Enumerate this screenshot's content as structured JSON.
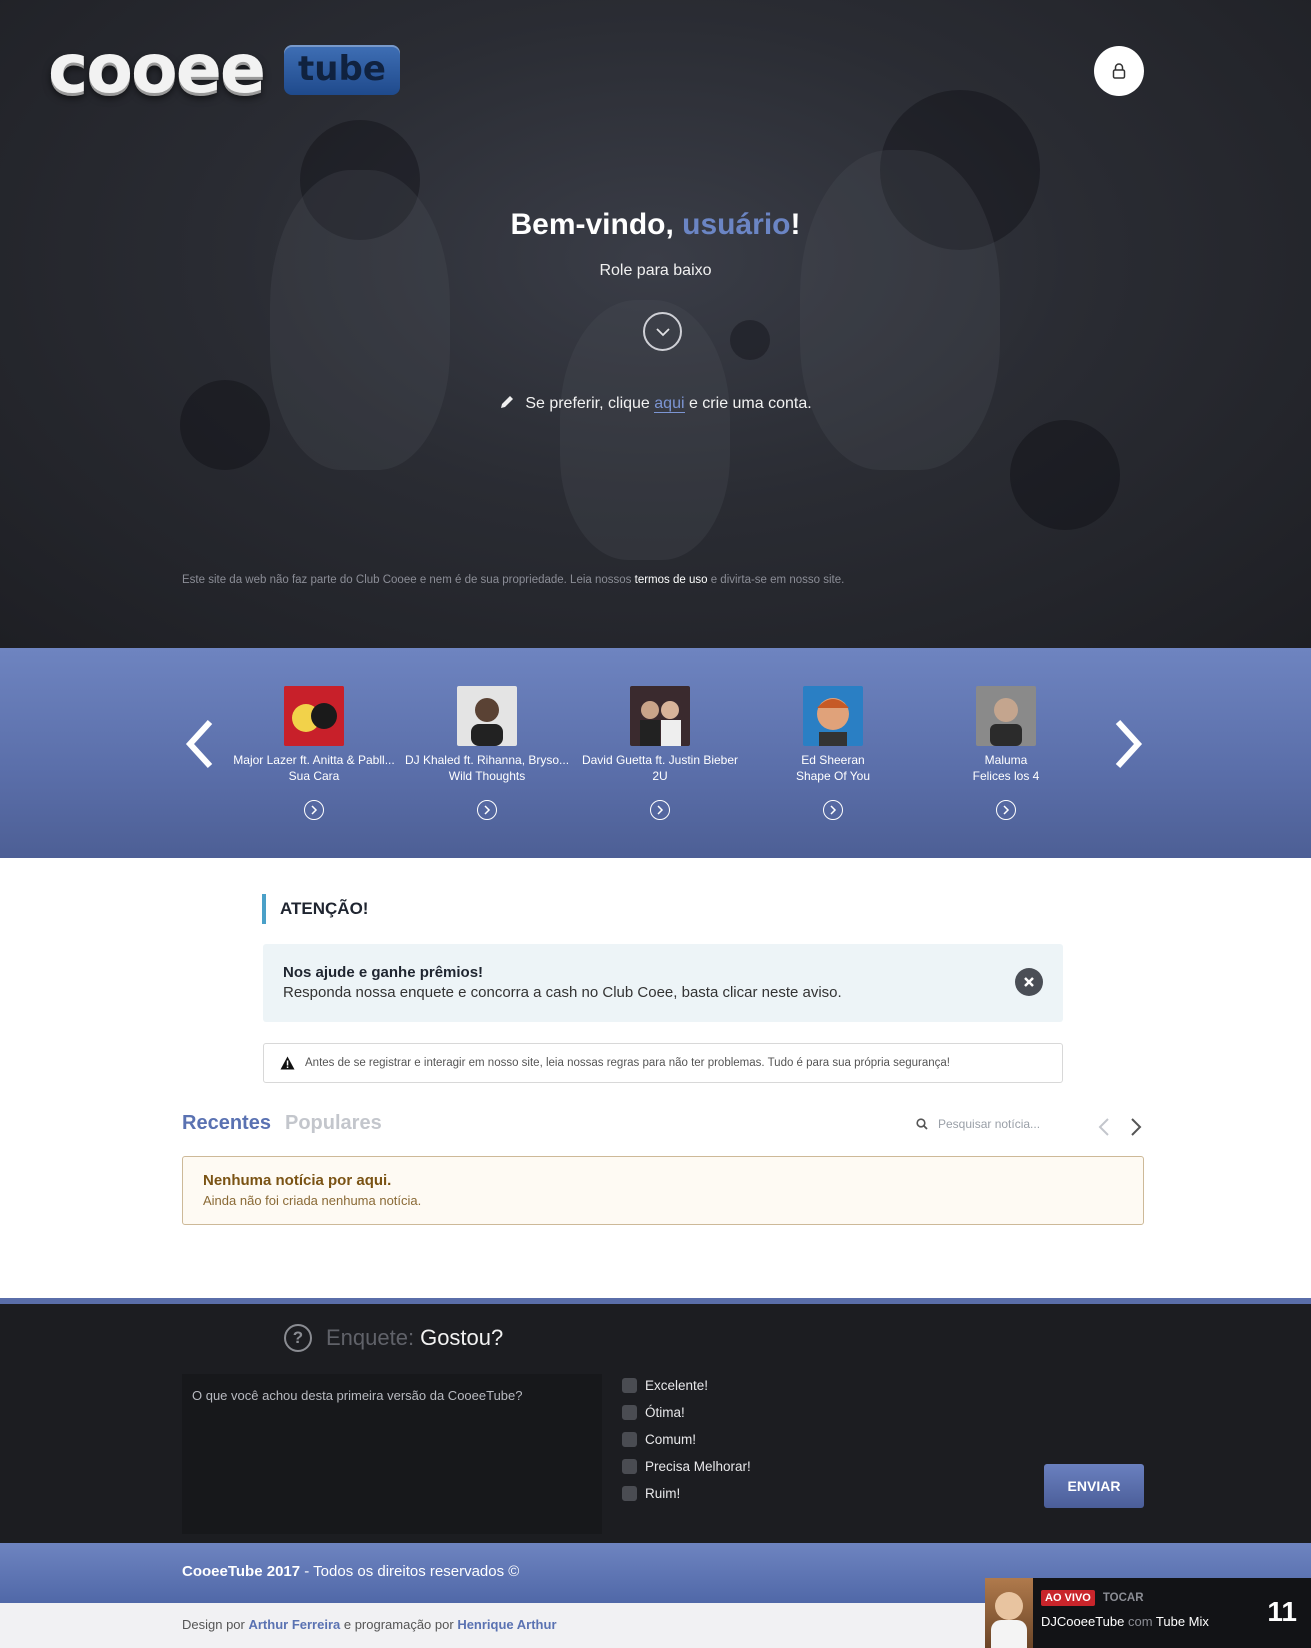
{
  "hero": {
    "welcome_prefix": "Bem-vindo, ",
    "username": "usuário",
    "welcome_suffix": "!",
    "scroll_hint": "Role para baixo",
    "cta_prefix": "Se preferir, clique ",
    "cta_link": "aqui",
    "cta_suffix": " e crie uma conta.",
    "disclaimer_prefix": "Este site da web não faz parte do Club Cooee e nem é de sua propriedade. Leia nossos ",
    "terms_link": "termos de uso",
    "disclaimer_suffix": " e divirta-se em nosso site."
  },
  "logo": {
    "main": "cooee",
    "badge": "tube"
  },
  "carousel": {
    "items": [
      {
        "artist": "Major Lazer ft. Anitta & Pabll...",
        "song": "Sua Cara",
        "thumb_color": "#c8202a"
      },
      {
        "artist": "DJ Khaled ft. Rihanna, Bryso...",
        "song": "Wild Thoughts",
        "thumb_color": "#d8d8d8"
      },
      {
        "artist": "David Guetta ft. Justin Bieber",
        "song": "2U",
        "thumb_color": "#3a2a2e"
      },
      {
        "artist": "Ed Sheeran",
        "song": "Shape Of You",
        "thumb_color": "#2a7fc4"
      },
      {
        "artist": "Maluma",
        "song": "Felices los 4",
        "thumb_color": "#7c7c7c"
      }
    ]
  },
  "attention": {
    "title": "ATENÇÃO!",
    "alert_title": "Nos ajude e ganhe prêmios!",
    "alert_text": "Responda nossa enquete e concorra a cash no Club Coee, basta clicar neste aviso.",
    "rules_text": "Antes de se registrar e interagir em nosso site, leia nossas regras para não ter problemas. Tudo é para sua própria segurança!"
  },
  "news": {
    "tab_recent": "Recentes",
    "tab_popular": "Populares",
    "search_placeholder": "Pesquisar notícia...",
    "empty_title": "Nenhuma notícia por aqui.",
    "empty_text": "Ainda não foi criada nenhuma notícia."
  },
  "poll": {
    "label": "Enquete:",
    "title": "Gostou?",
    "question": "O que você achou desta primeira versão da CooeeTube?",
    "options": [
      "Excelente!",
      "Ótima!",
      "Comum!",
      "Precisa Melhorar!",
      "Ruim!"
    ],
    "submit": "ENVIAR"
  },
  "footer": {
    "brand": "CooeeTube 2017",
    "rights": " - Todos os direitos reservados ©",
    "design_prefix": "Design por ",
    "designer": "Arthur Ferreira",
    "prog_prefix": " e programação por ",
    "programmer": "Henrique Arthur"
  },
  "player": {
    "live_badge": "AO VIVO",
    "play_label": "TOCAR",
    "dj": "DJCooeeTube",
    "with": " com ",
    "show": "Tube Mix",
    "listeners": "11"
  },
  "colors": {
    "accent": "#5a72b2",
    "hero_bg": "#2a2c33",
    "poll_bg": "#1c1d21",
    "live_red": "#c9252b"
  }
}
